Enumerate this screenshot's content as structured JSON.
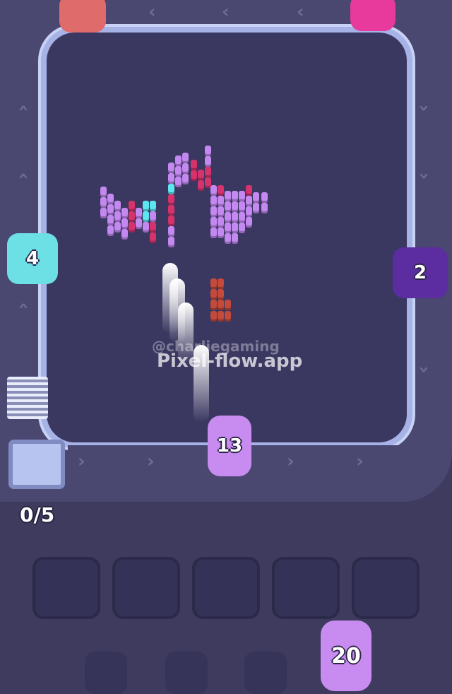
{
  "game": {
    "watermark_text": "Pixel-flow.app",
    "watermark_handle": "@charliegaming",
    "collected_counter": "0/5",
    "shooters": [
      {
        "id": "left",
        "color": "#6de0e6",
        "count": "4"
      },
      {
        "id": "right",
        "color": "#5b2da0",
        "count": "2"
      },
      {
        "id": "active",
        "color": "#c88cf0",
        "count": "13"
      },
      {
        "id": "queue",
        "color": "#c88cf0",
        "count": "20"
      },
      {
        "id": "top-red",
        "color": "#e06b6b",
        "count": ""
      },
      {
        "id": "top-pink",
        "color": "#e83a9c",
        "count": ""
      }
    ],
    "empty_slots": 5,
    "colors": {
      "board": "#3a3760",
      "rail": "#a7b3e6",
      "pixel_purple": "#c389f0",
      "pixel_cyan": "#5ee6ee",
      "pixel_magenta": "#d6336c",
      "pixel_red": "#c44a3b"
    }
  }
}
